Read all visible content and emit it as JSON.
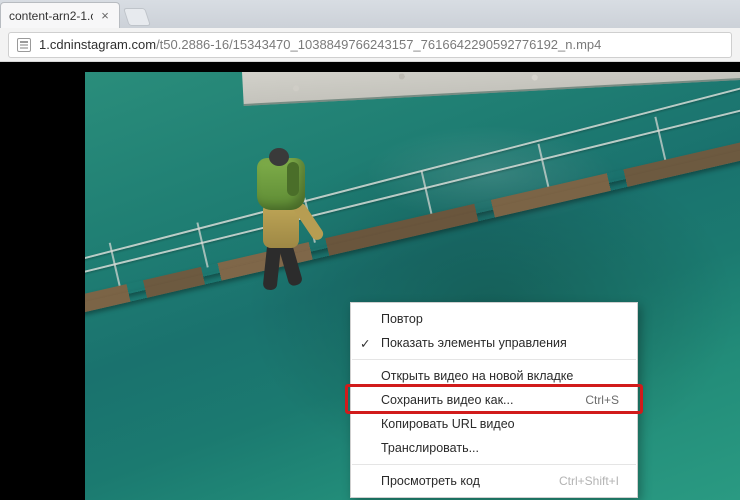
{
  "tab": {
    "title": "content-arn2-1.c",
    "close_glyph": "×"
  },
  "address": {
    "host": "1.cdninstagram.com",
    "path": "/t50.2886-16/15343470_1038849766243157_7616642290592776192_n.mp4"
  },
  "context_menu": {
    "items": [
      {
        "id": "loop",
        "label": "Повтор",
        "accel": "",
        "checked": false,
        "group": 1
      },
      {
        "id": "controls",
        "label": "Показать элементы управления",
        "accel": "",
        "checked": true,
        "group": 1
      },
      {
        "id": "open_newtab",
        "label": "Открыть видео на новой вкладке",
        "accel": "",
        "checked": false,
        "group": 2
      },
      {
        "id": "save_as",
        "label": "Сохранить видео как...",
        "accel": "Ctrl+S",
        "checked": false,
        "group": 2,
        "highlighted": true
      },
      {
        "id": "copy_url",
        "label": "Копировать URL видео",
        "accel": "",
        "checked": false,
        "group": 2
      },
      {
        "id": "cast",
        "label": "Транслировать...",
        "accel": "",
        "checked": false,
        "group": 2
      },
      {
        "id": "inspect",
        "label": "Просмотреть код",
        "accel": "Ctrl+Shift+I",
        "checked": false,
        "group": 3,
        "disabled_accel": true
      }
    ],
    "check_glyph": "✓"
  },
  "highlight_color": "#d11b1b"
}
